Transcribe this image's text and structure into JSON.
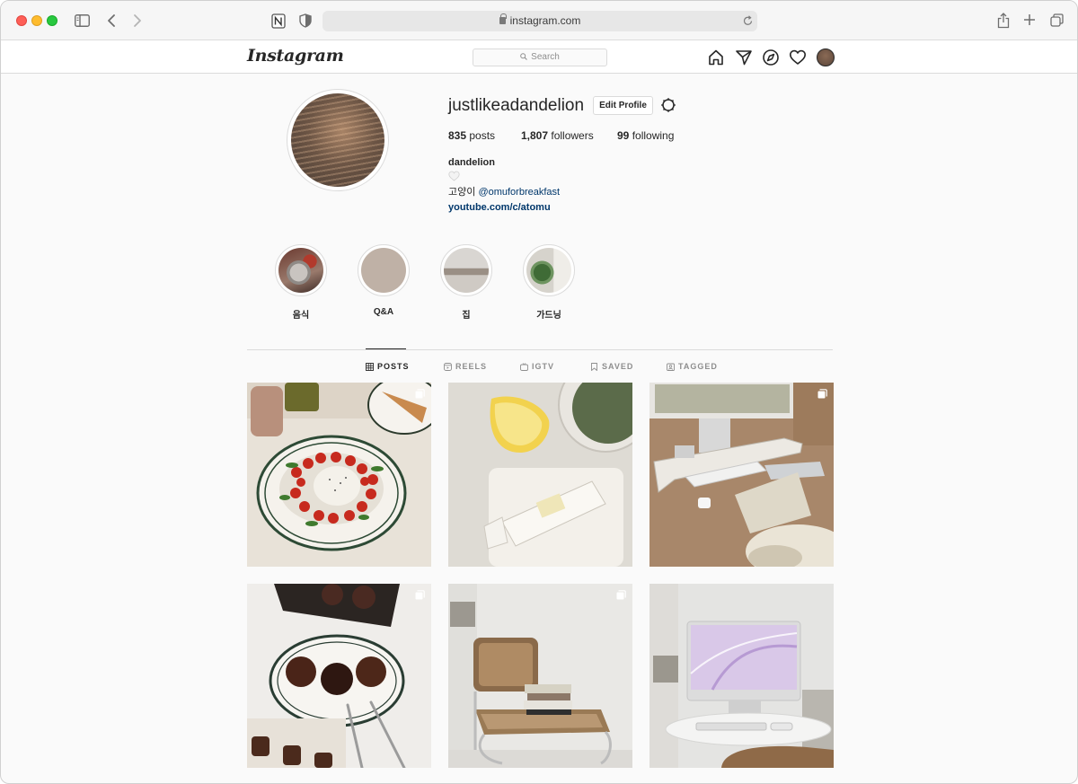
{
  "browser": {
    "url": "instagram.com"
  },
  "header": {
    "logo": "Instagram",
    "search_placeholder": "Search"
  },
  "profile": {
    "username": "justlikeadandelion",
    "edit_label": "Edit Profile",
    "stats": {
      "posts_count": "835",
      "posts_label": "posts",
      "followers_count": "1,807",
      "followers_label": "followers",
      "following_count": "99",
      "following_label": "following"
    },
    "bio": {
      "name": "dandelion",
      "heart": "🤍",
      "line_prefix": "고양이",
      "mention": "@omuforbreakfast",
      "link": "youtube.com/c/atomu"
    }
  },
  "highlights": [
    {
      "label": "음식"
    },
    {
      "label": "Q&A"
    },
    {
      "label": "집"
    },
    {
      "label": "가드닝"
    }
  ],
  "tabs": [
    {
      "label": "POSTS",
      "active": true
    },
    {
      "label": "REELS"
    },
    {
      "label": "IGTV"
    },
    {
      "label": "SAVED"
    },
    {
      "label": "TAGGED"
    }
  ],
  "colors": {
    "text": "#262626",
    "muted": "#8e8e8e",
    "link": "#00376b",
    "border": "#dbdbdb"
  }
}
